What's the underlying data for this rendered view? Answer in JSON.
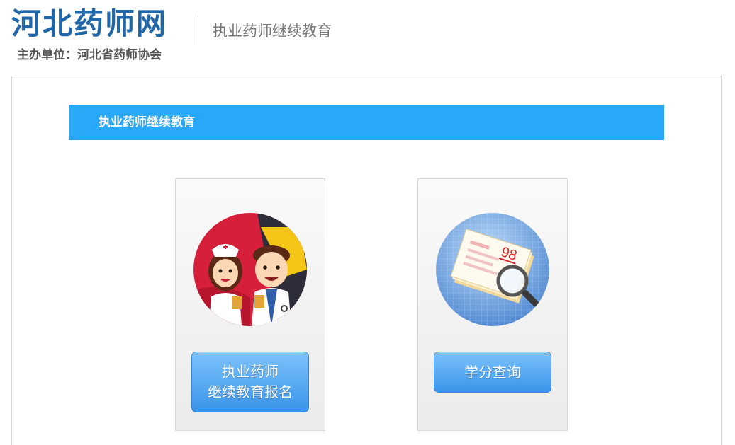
{
  "header": {
    "site_title": "河北药师网",
    "organizer": "主办单位：河北省药师协会",
    "tagline": "执业药师继续教育"
  },
  "section": {
    "title": "执业药师继续教育"
  },
  "cards": [
    {
      "icon": "nurse-and-doctor-icon",
      "button_lines": [
        "执业药师",
        "继续教育报名"
      ]
    },
    {
      "icon": "score-report-magnifier-icon",
      "button_lines": [
        "学分查询"
      ],
      "icon_text": "98"
    }
  ],
  "colors": {
    "brand": "#1f67a8",
    "section_bar": "#28a8f6",
    "button_top": "#7cc2fb",
    "button_bottom": "#3a94ea"
  }
}
